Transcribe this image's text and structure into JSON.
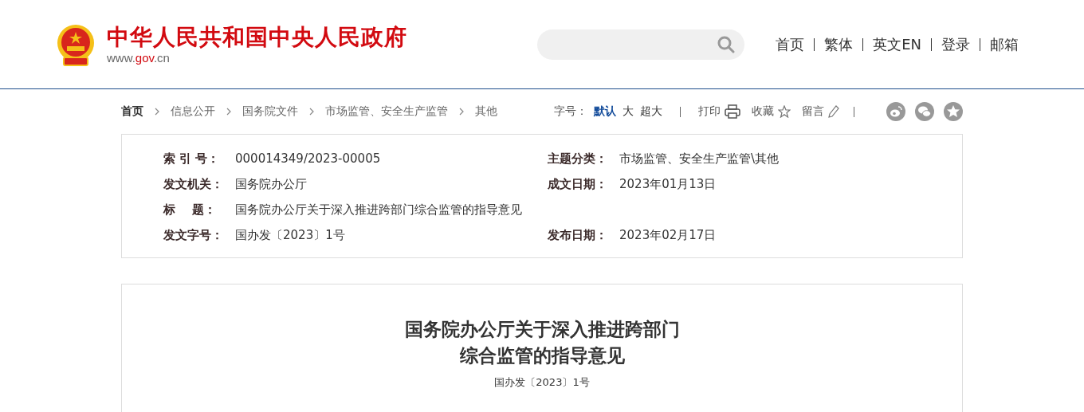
{
  "header": {
    "site_title": "中华人民共和国中央人民政府",
    "domain": {
      "prefix": "www.",
      "highlight": "gov",
      "suffix": ".cn"
    },
    "nav": [
      {
        "label": "首页"
      },
      {
        "label": "繁体"
      },
      {
        "label": "英文EN"
      },
      {
        "label": "登录"
      },
      {
        "label": "邮箱"
      }
    ]
  },
  "breadcrumb": [
    {
      "label": "首页",
      "current": true
    },
    {
      "label": "信息公开",
      "current": false
    },
    {
      "label": "国务院文件",
      "current": false
    },
    {
      "label": "市场监管、安全生产监管",
      "current": false
    },
    {
      "label": "其他",
      "current": false
    }
  ],
  "tools": {
    "font_size_label": "字号：",
    "font_sizes": [
      {
        "label": "默认",
        "selected": true
      },
      {
        "label": "大",
        "selected": false
      },
      {
        "label": "超大",
        "selected": false
      }
    ],
    "actions": [
      {
        "label": "打印",
        "kind": "print"
      },
      {
        "label": "收藏",
        "kind": "star"
      },
      {
        "label": "留言",
        "kind": "pencil"
      }
    ],
    "share": [
      {
        "kind": "weibo"
      },
      {
        "kind": "wechat"
      },
      {
        "kind": "qzone"
      }
    ]
  },
  "info": [
    {
      "label": "索 引 号：",
      "value": "000014349/2023-00005",
      "right_label": "主题分类：",
      "right_value": "市场监管、安全生产监管\\其他"
    },
    {
      "label": "发文机关：",
      "value": "国务院办公厅",
      "right_label": "成文日期：",
      "right_value": "2023年01月13日"
    },
    {
      "label": "标    题：",
      "value": "国务院办公厅关于深入推进跨部门综合监管的指导意见"
    },
    {
      "label": "发文字号：",
      "value": "国办发〔2023〕1号",
      "right_label": "发布日期：",
      "right_value": "2023年02月17日"
    }
  ],
  "article": {
    "title_lines": [
      "国务院办公厅关于深入推进跨部门",
      "综合监管的指导意见"
    ],
    "doc_number": "国办发〔2023〕1号"
  }
}
